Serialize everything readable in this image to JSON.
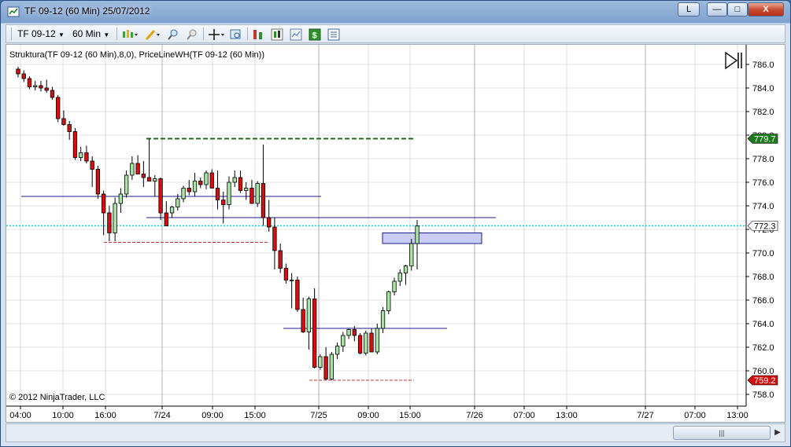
{
  "window": {
    "title": "TF 09-12 (60 Min)  25/07/2012",
    "buttons": {
      "link": "L",
      "minimize": "—",
      "maximize": "□",
      "close": "X"
    }
  },
  "toolbar": {
    "instrument": "TF 09-12",
    "interval": "60 Min",
    "tool_icons": [
      "bar-style-icon",
      "drawing-tool-icon",
      "zoom-in-icon",
      "zoom-out-icon",
      "crosshair-icon",
      "data-box-icon",
      "strategies-icon",
      "indicators-icon",
      "chart-trader-icon",
      "dollar-icon",
      "properties-icon"
    ]
  },
  "chart": {
    "indicator_label": "Struktura(TF 09-12 (60 Min),8,0), PriceLineWH(TF 09-12 (60 Min))",
    "copyright": "© 2012 NinjaTrader, LLC",
    "colors": {
      "up": "#a9e4a4",
      "down": "#d90e0e",
      "grid": "#c8c8c8",
      "price_line": "#00d7e6",
      "resistance": "#1e6b1e",
      "support": "#c83232",
      "structure": "#1c1c8c",
      "zone": "#c9ccf7"
    },
    "last_price_label": "772.3",
    "high_marker_label": "779.7",
    "low_marker_label": "759.2"
  },
  "chart_data": {
    "type": "candlestick",
    "y_ticks": [
      "786.0",
      "784.0",
      "782.0",
      "780.0",
      "778.0",
      "776.0",
      "774.0",
      "772.0",
      "770.0",
      "768.0",
      "766.0",
      "764.0",
      "762.0",
      "760.0",
      "758.0"
    ],
    "ylim": [
      757.4,
      786.8
    ],
    "x_ticks": [
      "04:00",
      "10:00",
      "16:00",
      "7/24",
      "09:00",
      "15:00",
      "7/25",
      "09:00",
      "15:00",
      "7/26",
      "07:00",
      "13:00",
      "7/27",
      "07:00",
      "13:00"
    ],
    "x_tick_positions": [
      18,
      72,
      126,
      198,
      262,
      316,
      397,
      460,
      513,
      595,
      658,
      712,
      812,
      875,
      929
    ],
    "candles": [
      [
        785.6,
        785.8,
        784.9,
        785.2
      ],
      [
        785.2,
        785.5,
        784.5,
        784.8
      ],
      [
        784.8,
        785.0,
        783.9,
        784.1
      ],
      [
        784.1,
        784.6,
        783.8,
        784.2
      ],
      [
        784.2,
        784.6,
        783.7,
        784.0
      ],
      [
        784.0,
        784.7,
        783.6,
        783.8
      ],
      [
        783.8,
        784.1,
        783.0,
        783.2
      ],
      [
        783.2,
        783.4,
        781.1,
        781.4
      ],
      [
        781.4,
        782.1,
        780.8,
        780.9
      ],
      [
        780.9,
        781.2,
        779.6,
        780.3
      ],
      [
        780.3,
        780.6,
        777.9,
        778.1
      ],
      [
        778.1,
        779.0,
        777.8,
        778.5
      ],
      [
        778.5,
        779.1,
        777.6,
        777.8
      ],
      [
        777.8,
        778.2,
        775.6,
        777.1
      ],
      [
        777.1,
        777.4,
        774.6,
        775.0
      ],
      [
        775.0,
        775.3,
        771.5,
        773.4
      ],
      [
        773.4,
        774.0,
        771.0,
        771.7
      ],
      [
        771.7,
        774.7,
        771.0,
        774.2
      ],
      [
        774.2,
        775.5,
        773.4,
        775.0
      ],
      [
        775.0,
        777.0,
        774.7,
        776.6
      ],
      [
        776.6,
        778.2,
        776.2,
        777.6
      ],
      [
        777.6,
        778.3,
        776.7,
        776.7
      ],
      [
        776.7,
        777.8,
        775.6,
        776.4
      ],
      [
        776.4,
        779.7,
        776.2,
        776.1
      ],
      [
        776.1,
        776.6,
        774.8,
        776.3
      ],
      [
        776.3,
        776.4,
        772.8,
        773.4
      ],
      [
        773.4,
        774.4,
        772.3,
        772.3
      ],
      [
        773.4,
        774.0,
        773.0,
        773.9
      ],
      [
        773.9,
        775.0,
        773.6,
        774.6
      ],
      [
        774.6,
        775.7,
        774.3,
        775.5
      ],
      [
        775.5,
        776.2,
        774.9,
        775.2
      ],
      [
        775.2,
        776.8,
        774.8,
        776.1
      ],
      [
        776.1,
        776.4,
        775.5,
        775.8
      ],
      [
        775.8,
        777.0,
        775.4,
        776.8
      ],
      [
        776.8,
        777.1,
        775.7,
        775.5
      ],
      [
        775.5,
        777.0,
        773.7,
        774.5
      ],
      [
        774.5,
        775.2,
        772.5,
        774.1
      ],
      [
        774.1,
        776.5,
        773.7,
        776.0
      ],
      [
        776.0,
        777.0,
        775.6,
        776.4
      ],
      [
        776.4,
        777.0,
        775.1,
        775.3
      ],
      [
        775.3,
        776.0,
        774.5,
        775.5
      ],
      [
        775.5,
        776.2,
        774.4,
        774.2
      ],
      [
        774.2,
        776.1,
        773.9,
        775.9
      ],
      [
        775.9,
        779.2,
        772.3,
        773.0
      ],
      [
        773.0,
        774.5,
        771.8,
        772.2
      ],
      [
        772.2,
        773.0,
        768.6,
        770.2
      ],
      [
        770.2,
        770.8,
        768.3,
        768.7
      ],
      [
        768.7,
        769.1,
        767.4,
        767.7
      ],
      [
        767.7,
        768.3,
        765.3,
        767.7
      ],
      [
        767.7,
        768.0,
        765.0,
        765.2
      ],
      [
        765.2,
        766.2,
        763.2,
        763.3
      ],
      [
        763.3,
        766.3,
        761.8,
        766.1
      ],
      [
        766.1,
        767.0,
        760.2,
        760.3
      ],
      [
        760.3,
        761.4,
        760.1,
        761.2
      ],
      [
        761.2,
        762.0,
        759.2,
        759.3
      ],
      [
        759.3,
        761.6,
        759.2,
        761.4
      ],
      [
        761.4,
        762.4,
        761.0,
        762.1
      ],
      [
        762.1,
        763.3,
        761.6,
        763.0
      ],
      [
        763.0,
        763.6,
        762.7,
        763.5
      ],
      [
        763.5,
        763.8,
        762.5,
        763.0
      ],
      [
        763.0,
        763.2,
        761.4,
        761.5
      ],
      [
        761.5,
        763.4,
        761.3,
        763.2
      ],
      [
        763.2,
        763.6,
        761.6,
        761.6
      ],
      [
        761.6,
        764.0,
        761.4,
        763.6
      ],
      [
        763.6,
        765.4,
        763.2,
        765.1
      ],
      [
        765.1,
        766.8,
        764.8,
        766.7
      ],
      [
        766.7,
        767.9,
        766.4,
        767.6
      ],
      [
        767.6,
        768.6,
        767.2,
        768.3
      ],
      [
        768.3,
        769.0,
        767.3,
        768.9
      ],
      [
        768.9,
        771.2,
        768.5,
        770.8
      ],
      [
        770.8,
        772.8,
        768.6,
        772.3
      ]
    ],
    "levels": [
      {
        "name": "resistance",
        "value": 779.7,
        "x0": 178,
        "x1": 518,
        "style": "dashed"
      },
      {
        "name": "structure-1",
        "value": 774.8,
        "x0": 19,
        "x1": 400,
        "style": "solid"
      },
      {
        "name": "structure-2",
        "value": 773.0,
        "x0": 178,
        "x1": 622,
        "style": "solid"
      },
      {
        "name": "support-1",
        "value": 770.9,
        "x0": 124,
        "x1": 332,
        "style": "dashed-thin"
      },
      {
        "name": "structure-3",
        "value": 763.6,
        "x0": 352,
        "x1": 560,
        "style": "solid"
      },
      {
        "name": "support-2",
        "value": 759.2,
        "x0": 385,
        "x1": 518,
        "style": "dashed-thin"
      }
    ],
    "zone": {
      "top": 771.7,
      "bottom": 770.8,
      "x0": 478,
      "x1": 604
    },
    "last_price": 772.3
  }
}
